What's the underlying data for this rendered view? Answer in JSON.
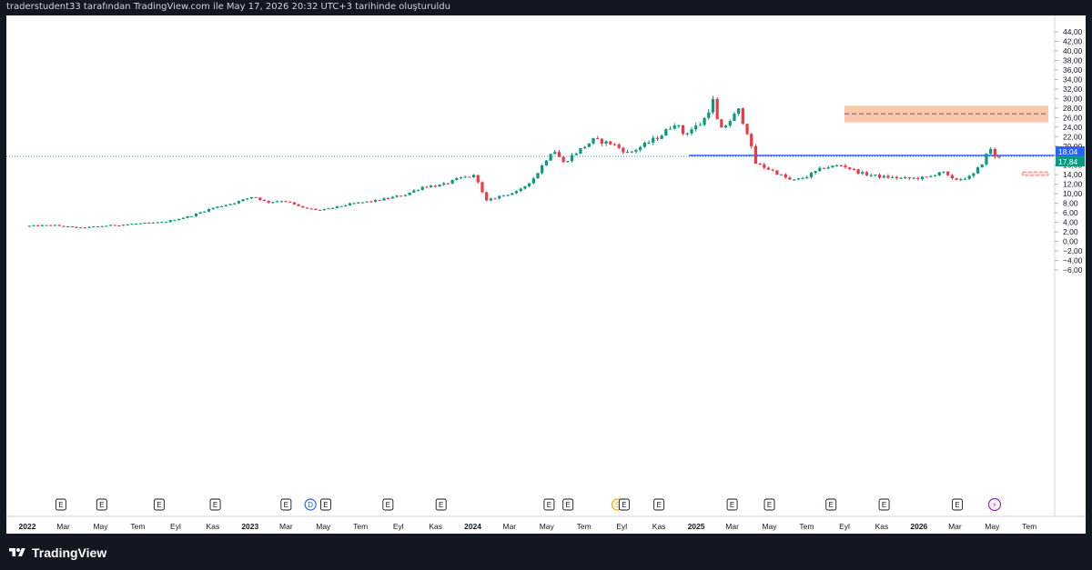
{
  "header": {
    "caption": "traderstudent33 tarafından TradingView.com ile May 17, 2026 20:32 UTC+3 tarihinde oluşturuldu"
  },
  "footer": {
    "brand": "TradingView"
  },
  "colors": {
    "background_frame": "#131722",
    "up_candle": "#089981",
    "down_candle": "#f23645",
    "support_line": "#2962ff",
    "resistance_zone": "#f8c9ad",
    "zone_midline": "#8e4b6e",
    "small_zone": "#f23645"
  },
  "chart_data": {
    "type": "candlestick",
    "x_axis": {
      "type": "date",
      "range": [
        "2022-01-01",
        "2026-08-01"
      ],
      "tick_labels": [
        {
          "label": "2022",
          "date": "2022-01-01",
          "bold": true
        },
        {
          "label": "Mar",
          "date": "2022-03-01"
        },
        {
          "label": "May",
          "date": "2022-05-01"
        },
        {
          "label": "Tem",
          "date": "2022-07-01"
        },
        {
          "label": "Eyl",
          "date": "2022-09-01"
        },
        {
          "label": "Kas",
          "date": "2022-11-01"
        },
        {
          "label": "2023",
          "date": "2023-01-01",
          "bold": true
        },
        {
          "label": "Mar",
          "date": "2023-03-01"
        },
        {
          "label": "May",
          "date": "2023-05-01"
        },
        {
          "label": "Tem",
          "date": "2023-07-01"
        },
        {
          "label": "Eyl",
          "date": "2023-09-01"
        },
        {
          "label": "Kas",
          "date": "2023-11-01"
        },
        {
          "label": "2024",
          "date": "2024-01-01",
          "bold": true
        },
        {
          "label": "Mar",
          "date": "2024-03-01"
        },
        {
          "label": "May",
          "date": "2024-05-01"
        },
        {
          "label": "Tem",
          "date": "2024-07-01"
        },
        {
          "label": "Eyl",
          "date": "2024-09-01"
        },
        {
          "label": "Kas",
          "date": "2024-11-01"
        },
        {
          "label": "2025",
          "date": "2025-01-01",
          "bold": true
        },
        {
          "label": "Mar",
          "date": "2025-03-01"
        },
        {
          "label": "May",
          "date": "2025-05-01"
        },
        {
          "label": "Tem",
          "date": "2025-07-01"
        },
        {
          "label": "Eyl",
          "date": "2025-09-01"
        },
        {
          "label": "Kas",
          "date": "2025-11-01"
        },
        {
          "label": "2026",
          "date": "2026-01-01",
          "bold": true
        },
        {
          "label": "Mar",
          "date": "2026-03-01"
        },
        {
          "label": "May",
          "date": "2026-05-01"
        },
        {
          "label": "Tem",
          "date": "2026-07-01"
        }
      ]
    },
    "y_axis": {
      "range": [
        -7,
        46
      ],
      "tick_labels": [
        "44,00",
        "42,00",
        "40,00",
        "38,00",
        "36,00",
        "34,00",
        "32,00",
        "30,00",
        "28,00",
        "26,00",
        "24,00",
        "22,00",
        "20,00",
        "18,00",
        "16,00",
        "14,00",
        "12,00",
        "10,00",
        "8,00",
        "6,00",
        "4,00",
        "2,00",
        "0,00",
        "−2,00",
        "−4,00",
        "−6,00"
      ],
      "tick_values": [
        44,
        42,
        40,
        38,
        36,
        34,
        32,
        30,
        28,
        26,
        24,
        22,
        20,
        18,
        16,
        14,
        12,
        10,
        8,
        6,
        4,
        2,
        0,
        -2,
        -4,
        -6
      ]
    },
    "price_labels": [
      {
        "text": "18,04",
        "value": 18.04,
        "color": "#2962ff"
      },
      {
        "text": "17,84",
        "value": 17.84,
        "color": "#089981"
      }
    ],
    "anchor_points": [
      [
        "2022-01-01",
        3.2
      ],
      [
        "2022-02-15",
        3.4
      ],
      [
        "2022-04-01",
        2.8
      ],
      [
        "2022-05-15",
        3.3
      ],
      [
        "2022-07-01",
        3.7
      ],
      [
        "2022-08-15",
        4.0
      ],
      [
        "2022-10-01",
        5.4
      ],
      [
        "2022-11-01",
        6.9
      ],
      [
        "2022-12-15",
        8.3
      ],
      [
        "2023-01-10",
        9.5
      ],
      [
        "2023-02-01",
        8.2
      ],
      [
        "2023-03-01",
        8.6
      ],
      [
        "2023-04-01",
        7.0
      ],
      [
        "2023-05-01",
        6.5
      ],
      [
        "2023-06-15",
        7.8
      ],
      [
        "2023-08-01",
        8.6
      ],
      [
        "2023-09-15",
        9.8
      ],
      [
        "2023-10-15",
        11.5
      ],
      [
        "2023-11-15",
        11.8
      ],
      [
        "2023-12-15",
        13.3
      ],
      [
        "2024-01-10",
        13.8
      ],
      [
        "2024-01-25",
        8.4
      ],
      [
        "2024-02-20",
        9.6
      ],
      [
        "2024-03-20",
        10.5
      ],
      [
        "2024-04-15",
        13.5
      ],
      [
        "2024-05-15",
        19.5
      ],
      [
        "2024-06-01",
        16.5
      ],
      [
        "2024-06-20",
        18.5
      ],
      [
        "2024-07-20",
        21.3
      ],
      [
        "2024-08-20",
        20.5
      ],
      [
        "2024-09-15",
        18.5
      ],
      [
        "2024-10-15",
        20.5
      ],
      [
        "2024-11-10",
        22.5
      ],
      [
        "2024-12-01",
        25.0
      ],
      [
        "2024-12-15",
        22.5
      ],
      [
        "2025-01-15",
        25.0
      ],
      [
        "2025-02-01",
        29.5
      ],
      [
        "2025-02-12",
        23.0
      ],
      [
        "2025-03-05",
        26.0
      ],
      [
        "2025-03-15",
        27.5
      ],
      [
        "2025-04-01",
        22.0
      ],
      [
        "2025-04-10",
        16.5
      ],
      [
        "2025-05-10",
        14.8
      ],
      [
        "2025-06-10",
        12.7
      ],
      [
        "2025-07-01",
        13.4
      ],
      [
        "2025-08-01",
        15.5
      ],
      [
        "2025-09-01",
        16.0
      ],
      [
        "2025-10-01",
        14.3
      ],
      [
        "2025-11-01",
        13.6
      ],
      [
        "2025-12-15",
        13.2
      ],
      [
        "2026-01-20",
        13.4
      ],
      [
        "2026-02-10",
        14.8
      ],
      [
        "2026-03-01",
        12.9
      ],
      [
        "2026-04-01",
        13.6
      ],
      [
        "2026-04-20",
        16.8
      ],
      [
        "2026-05-01",
        19.8
      ],
      [
        "2026-05-10",
        17.3
      ],
      [
        "2026-05-15",
        17.84
      ]
    ],
    "horizontal_levels": [
      {
        "name": "support",
        "value": 18.04,
        "from": "2024-12-20",
        "style": "solid"
      },
      {
        "name": "price-dotted",
        "value": 17.84,
        "style": "dotted"
      }
    ],
    "zones": [
      {
        "name": "resistance-zone",
        "from": "2025-09-01",
        "to": "2026-08-01",
        "low": 25.0,
        "high": 28.5,
        "midline": 26.8
      },
      {
        "name": "small-zone",
        "from": "2026-06-20",
        "to": "2026-08-01",
        "low": 14.2,
        "high": 14.6
      }
    ],
    "events": [
      {
        "date": "2022-02-25",
        "letter": "E"
      },
      {
        "date": "2022-05-03",
        "letter": "E"
      },
      {
        "date": "2022-08-05",
        "letter": "E"
      },
      {
        "date": "2022-11-05",
        "letter": "E"
      },
      {
        "date": "2023-03-01",
        "letter": "E"
      },
      {
        "date": "2023-04-10",
        "letter": "D",
        "style": "dividend"
      },
      {
        "date": "2023-05-05",
        "letter": "E"
      },
      {
        "date": "2023-08-15",
        "letter": "E"
      },
      {
        "date": "2023-11-10",
        "letter": "E"
      },
      {
        "date": "2024-05-05",
        "letter": "E"
      },
      {
        "date": "2024-06-05",
        "letter": "E"
      },
      {
        "date": "2024-08-25",
        "letter": "S",
        "style": "split"
      },
      {
        "date": "2024-09-05",
        "letter": "E"
      },
      {
        "date": "2024-11-01",
        "letter": "E"
      },
      {
        "date": "2025-03-01",
        "letter": "E"
      },
      {
        "date": "2025-05-01",
        "letter": "E"
      },
      {
        "date": "2025-08-10",
        "letter": "E"
      },
      {
        "date": "2025-11-05",
        "letter": "E"
      },
      {
        "date": "2026-03-05",
        "letter": "E"
      },
      {
        "date": "2026-05-05",
        "letter": "⚡",
        "style": "flash"
      }
    ],
    "title": "",
    "xlabel": "",
    "ylabel": "",
    "grid": false,
    "legend": "none"
  }
}
